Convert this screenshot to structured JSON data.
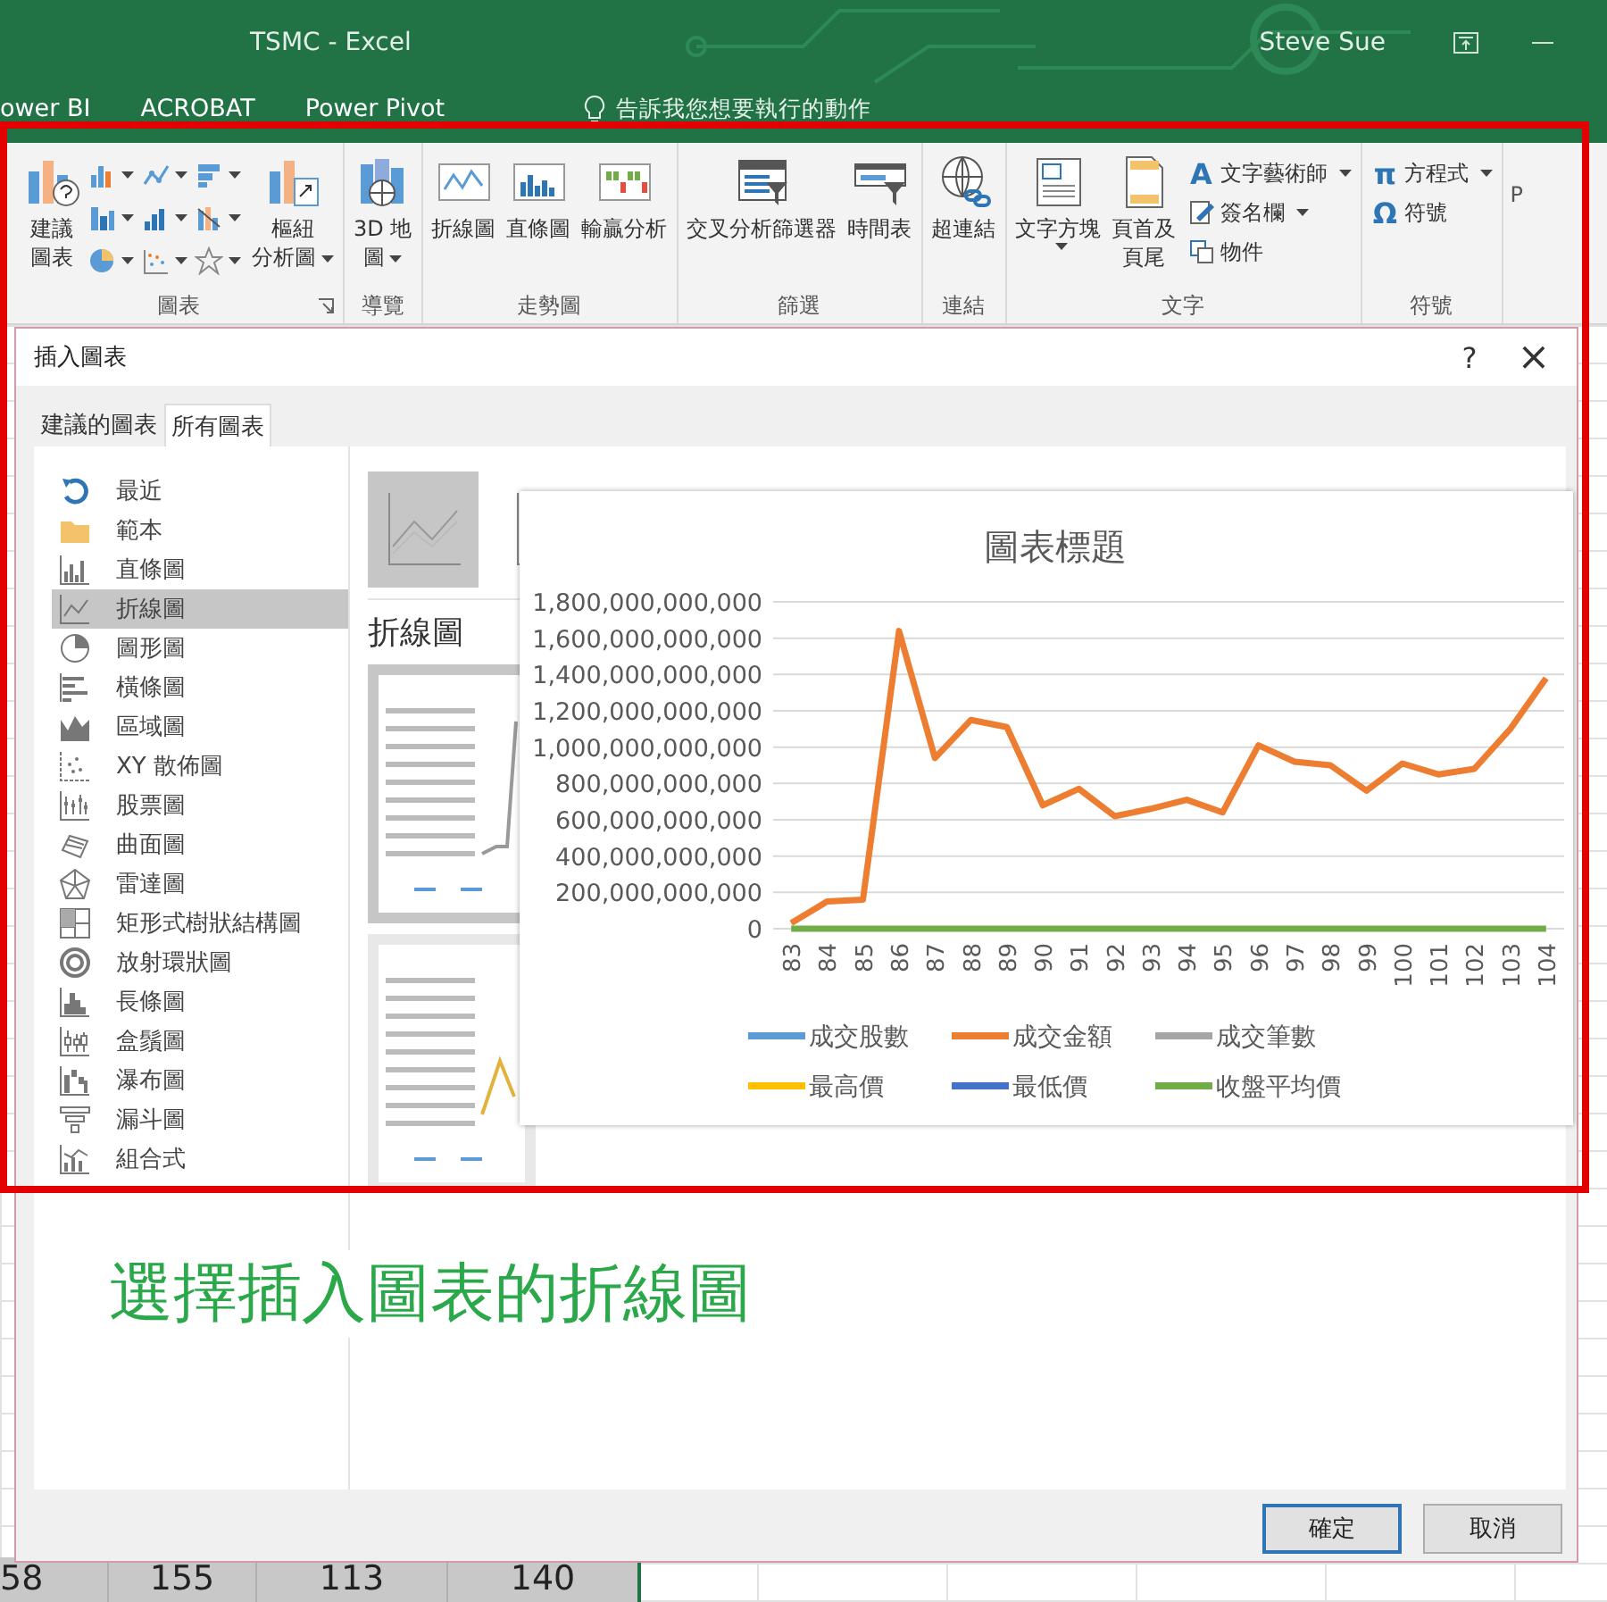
{
  "window": {
    "title": "TSMC - Excel",
    "user": "Steve Sue"
  },
  "menu": {
    "items": [
      "ower BI",
      "ACROBAT",
      "Power Pivot"
    ],
    "search_placeholder": "告訴我您想要執行的動作"
  },
  "ribbon": {
    "groups": [
      {
        "label": "圖表",
        "launcher": true,
        "buttons": [
          {
            "kind": "large",
            "lines": [
              "建議",
              "圖表"
            ],
            "dropdown": false
          },
          {
            "kind": "gallery"
          },
          {
            "kind": "large",
            "lines": [
              "樞紐",
              "分析圖"
            ],
            "dropdown": true
          }
        ]
      },
      {
        "label": "導覽",
        "launcher": false,
        "buttons": [
          {
            "kind": "large",
            "lines": [
              "3D 地",
              "圖"
            ],
            "dropdown": true
          }
        ]
      },
      {
        "label": "走勢圖",
        "launcher": false,
        "buttons": [
          {
            "kind": "large",
            "lines": [
              "折線圖"
            ],
            "dropdown": false
          },
          {
            "kind": "large",
            "lines": [
              "直條圖"
            ],
            "dropdown": false
          },
          {
            "kind": "large",
            "lines": [
              "輸贏分析"
            ],
            "dropdown": false
          }
        ]
      },
      {
        "label": "篩選",
        "launcher": false,
        "buttons": [
          {
            "kind": "large",
            "lines": [
              "交叉分析篩選器"
            ],
            "dropdown": false
          },
          {
            "kind": "large",
            "lines": [
              "時間表"
            ],
            "dropdown": false
          }
        ]
      },
      {
        "label": "連結",
        "launcher": false,
        "buttons": [
          {
            "kind": "large",
            "lines": [
              "超連結"
            ],
            "dropdown": false
          }
        ]
      },
      {
        "label": "文字",
        "launcher": false,
        "buttons": [
          {
            "kind": "large",
            "lines": [
              "文字方塊"
            ],
            "dropdown": true
          },
          {
            "kind": "large",
            "lines": [
              "頁首及",
              "頁尾"
            ],
            "dropdown": false
          },
          {
            "kind": "small",
            "glyph": "A",
            "lines": [
              "文字藝術師"
            ],
            "dropdown": true
          },
          {
            "kind": "small",
            "lines": [
              "簽名欄"
            ],
            "dropdown": true
          },
          {
            "kind": "small",
            "lines": [
              "物件"
            ],
            "dropdown": false
          }
        ]
      },
      {
        "label": "符號",
        "launcher": false,
        "buttons": [
          {
            "kind": "small",
            "glyph": "π",
            "lines": [
              "方程式"
            ],
            "dropdown": true
          },
          {
            "kind": "small",
            "glyph": "Ω",
            "lines": [
              "符號"
            ],
            "dropdown": false
          }
        ]
      }
    ],
    "next_group_label": "P"
  },
  "dialog": {
    "title": "插入圖表",
    "help": "?",
    "close": "×",
    "tabs": [
      {
        "label": "建議的圖表",
        "selected": false
      },
      {
        "label": "所有圖表",
        "selected": true
      }
    ],
    "categories": [
      {
        "label": "最近",
        "selected": false
      },
      {
        "label": "範本",
        "selected": false
      },
      {
        "label": "直條圖",
        "selected": false
      },
      {
        "label": "折線圖",
        "selected": true
      },
      {
        "label": "圖形圖",
        "selected": false
      },
      {
        "label": "橫條圖",
        "selected": false
      },
      {
        "label": "區域圖",
        "selected": false
      },
      {
        "label": "XY 散佈圖",
        "selected": false
      },
      {
        "label": "股票圖",
        "selected": false
      },
      {
        "label": "曲面圖",
        "selected": false
      },
      {
        "label": "雷達圖",
        "selected": false
      },
      {
        "label": "矩形式樹狀結構圖",
        "selected": false
      },
      {
        "label": "放射環狀圖",
        "selected": false
      },
      {
        "label": "長條圖",
        "selected": false
      },
      {
        "label": "盒鬚圖",
        "selected": false
      },
      {
        "label": "瀑布圖",
        "selected": false
      },
      {
        "label": "漏斗圖",
        "selected": false
      },
      {
        "label": "組合式",
        "selected": false
      }
    ],
    "subtypes": [
      {
        "selected": true
      },
      {
        "selected": false
      }
    ],
    "heading": "折線圖",
    "previews": [
      {
        "selected": true
      },
      {
        "selected": false
      }
    ],
    "chart_data": {
      "type": "line",
      "title": "圖表標題",
      "categories": [
        "83",
        "84",
        "85",
        "86",
        "87",
        "88",
        "89",
        "90",
        "91",
        "92",
        "93",
        "94",
        "95",
        "96",
        "97",
        "98",
        "99",
        "100",
        "101",
        "102",
        "103",
        "104"
      ],
      "series": [
        {
          "name": "成交股數",
          "color": "#5b9bd5",
          "values": [
            null,
            null,
            null,
            null,
            null,
            null,
            null,
            null,
            null,
            null,
            null,
            null,
            null,
            null,
            null,
            null,
            null,
            null,
            null,
            null,
            null,
            null
          ]
        },
        {
          "name": "成交金額",
          "color": "#ed7d31",
          "values": [
            30000000000,
            150000000000,
            160000000000,
            1640000000000,
            940000000000,
            1150000000000,
            1110000000000,
            680000000000,
            770000000000,
            620000000000,
            660000000000,
            710000000000,
            640000000000,
            1010000000000,
            920000000000,
            900000000000,
            760000000000,
            910000000000,
            850000000000,
            880000000000,
            1100000000000,
            1380000000000
          ]
        },
        {
          "name": "成交筆數",
          "color": "#a5a5a5",
          "values": [
            null,
            null,
            null,
            null,
            null,
            null,
            null,
            null,
            null,
            null,
            null,
            null,
            null,
            null,
            null,
            null,
            null,
            null,
            null,
            null,
            null,
            null
          ]
        },
        {
          "name": "最高價",
          "color": "#ffc000",
          "values": [
            null,
            null,
            null,
            null,
            null,
            null,
            null,
            null,
            null,
            null,
            null,
            null,
            null,
            null,
            null,
            null,
            null,
            null,
            null,
            null,
            null,
            null
          ]
        },
        {
          "name": "最低價",
          "color": "#4472c4",
          "values": [
            null,
            null,
            null,
            null,
            null,
            null,
            null,
            null,
            null,
            null,
            null,
            null,
            null,
            null,
            null,
            null,
            null,
            null,
            null,
            null,
            null,
            null
          ]
        },
        {
          "name": "收盤平均價",
          "color": "#70ad47",
          "values": [
            0,
            0,
            0,
            0,
            0,
            0,
            0,
            0,
            0,
            0,
            0,
            0,
            0,
            0,
            0,
            0,
            0,
            0,
            0,
            0,
            0,
            0
          ]
        }
      ],
      "ylim": [
        0,
        1800000000000
      ],
      "grid": true,
      "legend": "bottom",
      "yticks": [
        {
          "value": 0,
          "label": "0"
        },
        {
          "value": 200000000000,
          "label": "200,000,000,000"
        },
        {
          "value": 400000000000,
          "label": "400,000,000,000"
        },
        {
          "value": 600000000000,
          "label": "600,000,000,000"
        },
        {
          "value": 800000000000,
          "label": "800,000,000,000"
        },
        {
          "value": 1000000000000,
          "label": "1,000,000,000,000"
        },
        {
          "value": 1200000000000,
          "label": "1,200,000,000,000"
        },
        {
          "value": 1400000000000,
          "label": "1,400,000,000,000"
        },
        {
          "value": 1600000000000,
          "label": "1,600,000,000,000"
        },
        {
          "value": 1800000000000,
          "label": "1,800,000,000,000"
        }
      ]
    },
    "caption": "選擇插入圖表的折線圖",
    "buttons": [
      {
        "label": "確定",
        "default": true
      },
      {
        "label": "取消",
        "default": false
      }
    ]
  },
  "sheet": {
    "cells": [
      "58",
      "155",
      "113",
      "140"
    ]
  }
}
